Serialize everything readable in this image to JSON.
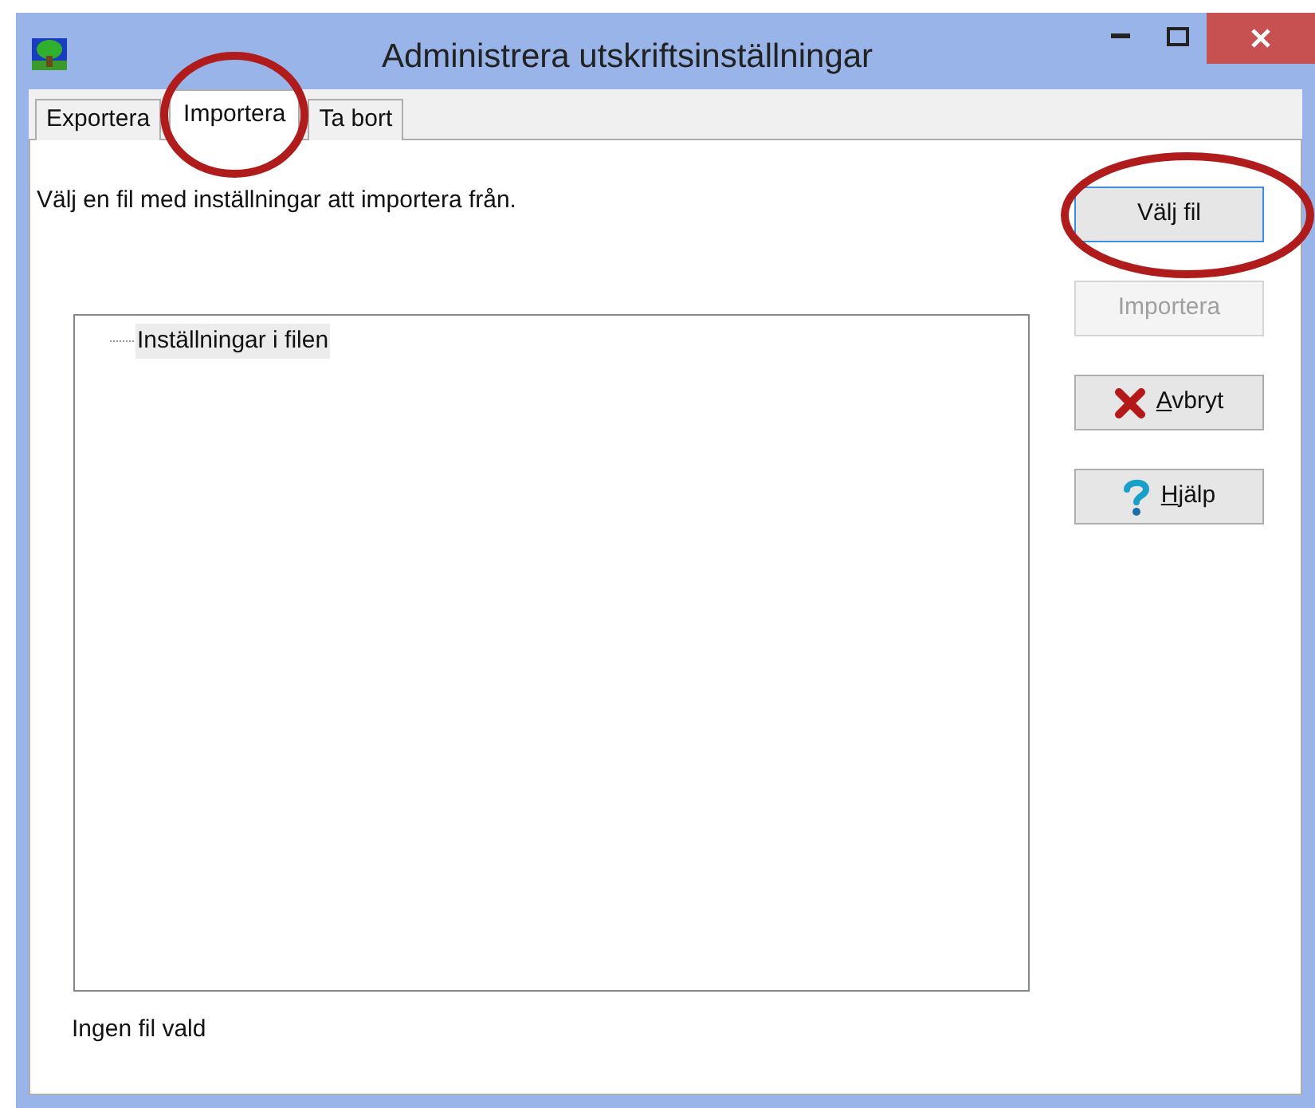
{
  "window": {
    "title": "Administrera utskriftsinställningar"
  },
  "tabs": [
    {
      "label": "Exportera",
      "selected": false,
      "circled": false
    },
    {
      "label": "Importera",
      "selected": true,
      "circled": true
    },
    {
      "label": "Ta bort",
      "selected": false,
      "circled": false
    }
  ],
  "instruction": "Välj en fil med inställningar att importera från.",
  "tree": {
    "items": [
      {
        "label": "Inställningar i filen",
        "selected": true
      }
    ]
  },
  "status": "Ingen fil vald",
  "buttons": [
    {
      "kind": "plain",
      "label": "Välj fil",
      "focused": true,
      "disabled": false,
      "circled": true
    },
    {
      "kind": "plain",
      "label": "Importera",
      "focused": false,
      "disabled": true,
      "circled": false
    },
    {
      "kind": "cancel",
      "label": "Avbryt",
      "first_letter_underlined": true,
      "focused": false,
      "disabled": false,
      "circled": false
    },
    {
      "kind": "help",
      "label": "Hjälp",
      "first_letter_underlined": true,
      "focused": false,
      "disabled": false,
      "circled": false
    }
  ]
}
